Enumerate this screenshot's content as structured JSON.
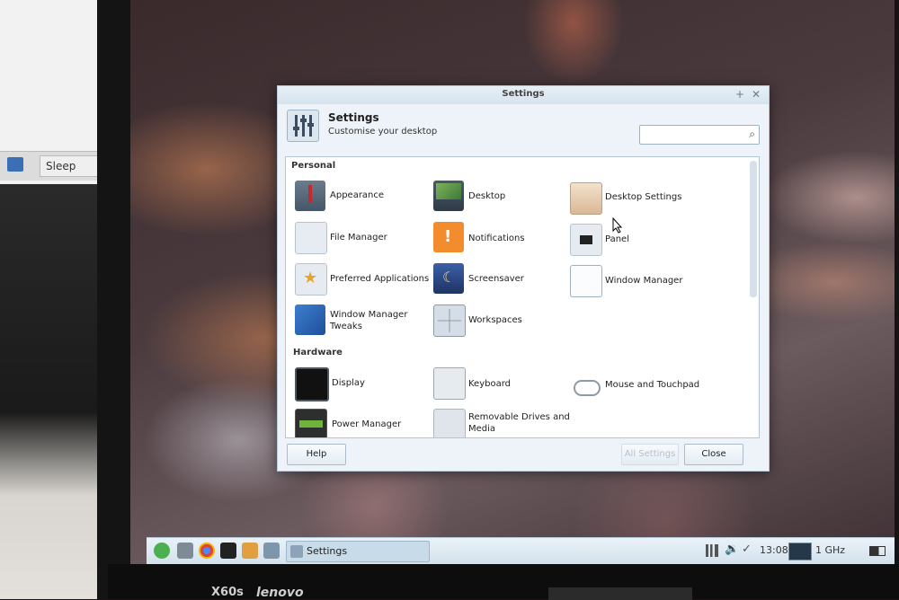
{
  "left_monitor": {
    "tab_label": "Sleep"
  },
  "window": {
    "title": "Settings",
    "header_title": "Settings",
    "header_subtitle": "Customise your desktop",
    "search": {
      "value": "",
      "placeholder": ""
    }
  },
  "categories": {
    "personal": "Personal",
    "hardware": "Hardware"
  },
  "personal_items": {
    "appearance": "Appearance",
    "desktop": "Desktop",
    "desktop_settings": "Desktop Settings",
    "file_manager": "File Manager",
    "notifications": "Notifications",
    "panel": "Panel",
    "preferred_applications": "Preferred Applications",
    "screensaver": "Screensaver",
    "window_manager": "Window Manager",
    "window_manager_tweaks_1": "Window Manager",
    "window_manager_tweaks_2": "Tweaks",
    "workspaces": "Workspaces"
  },
  "hardware_items": {
    "display": "Display",
    "keyboard": "Keyboard",
    "mouse_touchpad": "Mouse and Touchpad",
    "power_manager": "Power Manager",
    "removable_1": "Removable Drives and",
    "removable_2": "Media"
  },
  "buttons": {
    "help": "Help",
    "all_settings": "All Settings",
    "close": "Close"
  },
  "taskbar": {
    "task_label": "Settings",
    "clock": "13:08",
    "cpu_freq": "1 GHz"
  },
  "laptop": {
    "model": "X60s",
    "brand": "lenovo"
  }
}
